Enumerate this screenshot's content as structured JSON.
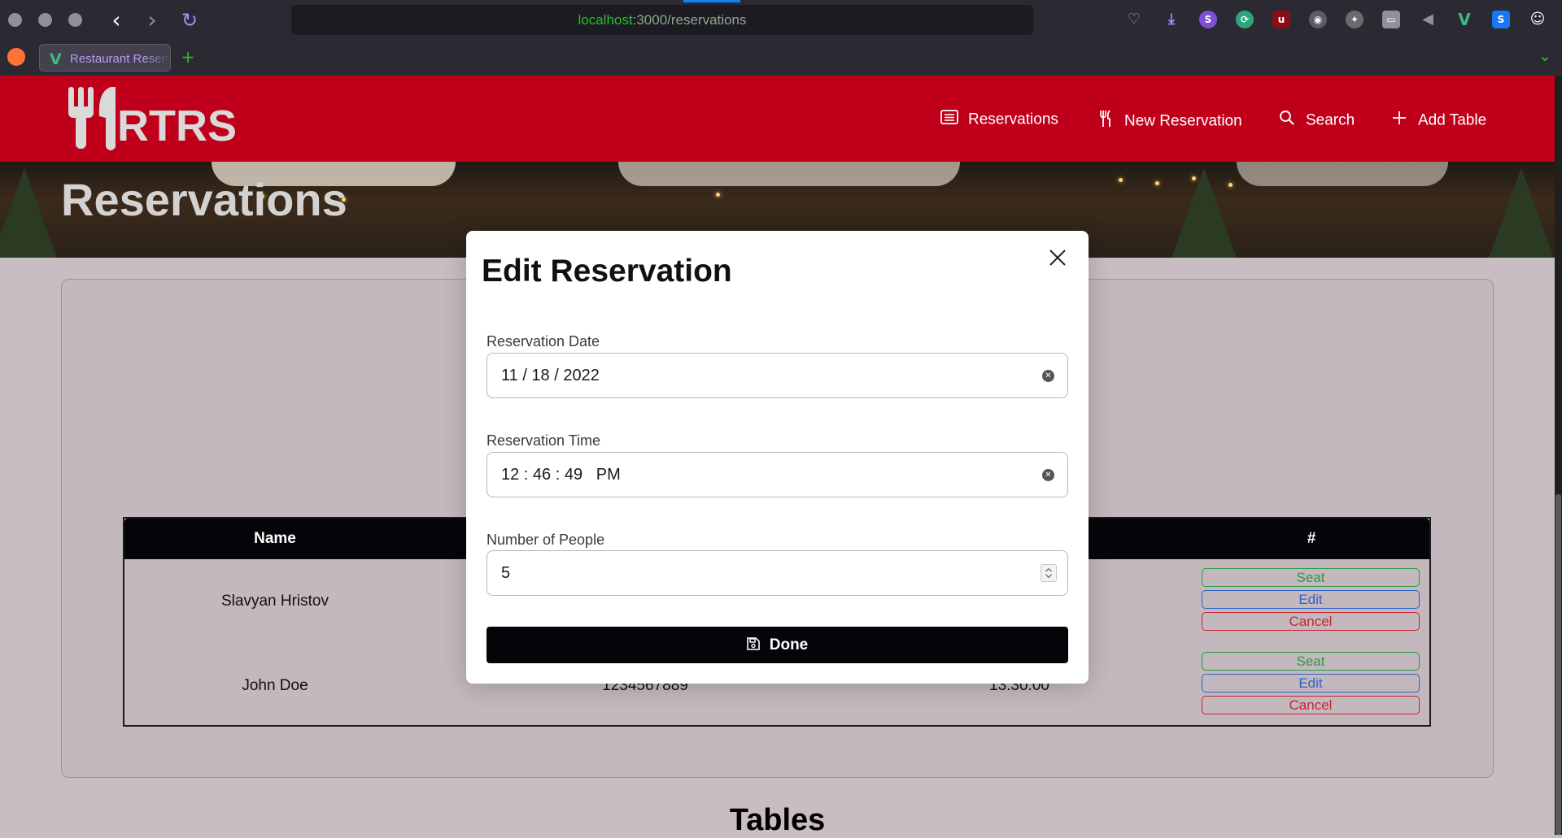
{
  "browser": {
    "url_host": "localhost",
    "url_path": ":3000/reservations",
    "tab_title": "Restaurant Reservations",
    "new_tab": "+",
    "back": "‹",
    "forward": "›",
    "reload": "↻",
    "tabs_menu": "⌄"
  },
  "header": {
    "logo_text": "RTRS",
    "nav": [
      {
        "label": "Reservations",
        "icon": "list-icon"
      },
      {
        "label": "New Reservation",
        "icon": "utensils-icon"
      },
      {
        "label": "Search",
        "icon": "search-icon"
      },
      {
        "label": "Add Table",
        "icon": "plus-icon"
      }
    ]
  },
  "hero": {
    "title": "Reservations"
  },
  "reservations_table": {
    "columns": [
      "Name",
      "#"
    ],
    "rows": [
      {
        "name": "Slavyan Hristov",
        "actions": [
          "Seat",
          "Edit",
          "Cancel"
        ]
      },
      {
        "name": "John Doe",
        "mobile": "1234567889",
        "time": "13:30:00",
        "actions": [
          "Seat",
          "Edit",
          "Cancel"
        ]
      }
    ]
  },
  "tables_heading": "Tables",
  "modal": {
    "title": "Edit Reservation",
    "date_label": "Reservation Date",
    "date_value": "11 / 18 / 2022",
    "time_label": "Reservation Time",
    "time_value": "12 : 46 : 49   PM",
    "people_label": "Number of People",
    "people_value": "5",
    "done_label": "Done"
  },
  "colors": {
    "brand_red": "#c0001a",
    "seat": "#2d9a3e",
    "edit": "#2e61c9",
    "cancel": "#c9232f"
  }
}
